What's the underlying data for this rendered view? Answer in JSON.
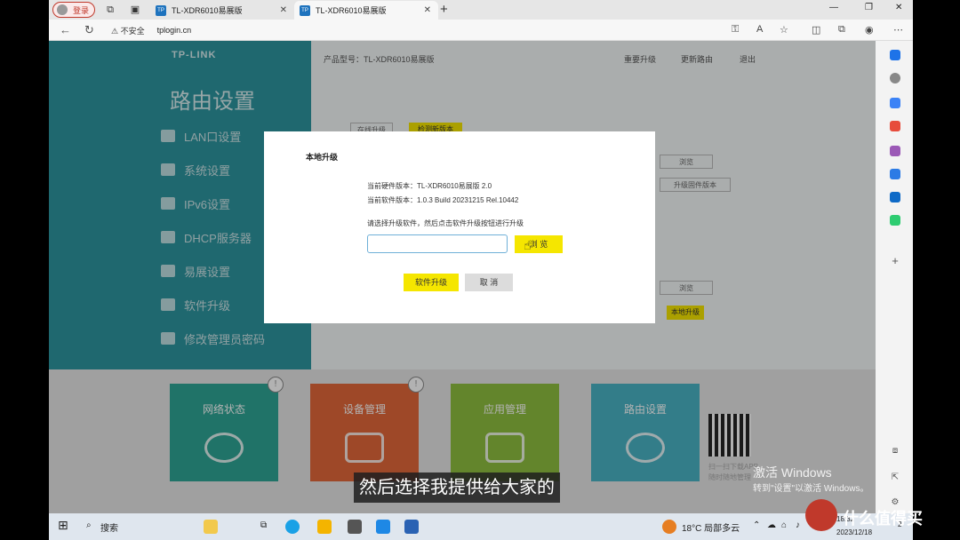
{
  "tabstrip": {
    "profile_label": "登录",
    "tabs": [
      {
        "favicon": "TP",
        "title": "TL-XDR6010易展版"
      },
      {
        "favicon": "TP",
        "title": "TL-XDR6010易展版"
      }
    ],
    "newtab_glyph": "+",
    "close_glyph": "✕",
    "win_min": "—",
    "win_max": "❐",
    "win_close": "✕"
  },
  "addressbar": {
    "security": "不安全",
    "url": "tplogin.cn"
  },
  "router": {
    "logo": "TP-LINK",
    "section_title": "路由设置",
    "side_items": [
      "LAN口设置",
      "系统设置",
      "IPv6设置",
      "DHCP服务器",
      "易展设置",
      "软件升级",
      "修改管理员密码"
    ],
    "header_model": "产品型号：TL-XDR6010易展版",
    "header_links": [
      "重要升级",
      "更新路由",
      "退出"
    ],
    "main_buttons": [
      "在线升级",
      "检测新版本",
      "浏览",
      "升级固件版本",
      "浏览",
      "本地升级"
    ],
    "tiles": [
      {
        "label": "网络状态",
        "badge": "!",
        "color": "#2ea595"
      },
      {
        "label": "设备管理",
        "badge": "!",
        "color": "#e2683a"
      },
      {
        "label": "应用管理",
        "badge": "",
        "color": "#8fbf3f"
      },
      {
        "label": "路由设置",
        "badge": "",
        "color": "#49b3c4"
      }
    ],
    "qr_caption": [
      "扫一扫下载APP",
      "随时随地管理"
    ]
  },
  "dialog": {
    "title": "本地升级",
    "hardware_version": "当前硬件版本：TL-XDR6010易展版 2.0",
    "software_version": "当前软件版本：1.0.3 Build 20231215 Rel.10442",
    "instruction": "请选择升级软件，然后点击软件升级按钮进行升级",
    "file_value": "",
    "browse_label": "浏 览",
    "upgrade_label": "软件升级",
    "cancel_label": "取 消"
  },
  "windows_activation": {
    "line1": "激活 Windows",
    "line2": "转到\"设置\"以激活 Windows。"
  },
  "subtitle": "然后选择我提供给大家的",
  "taskbar": {
    "search": "搜索",
    "weather": "18°C 局部多云",
    "time": "18:32",
    "date": "2023/12/18",
    "notif_count": "2"
  },
  "brand_watermark": "什么值得买"
}
